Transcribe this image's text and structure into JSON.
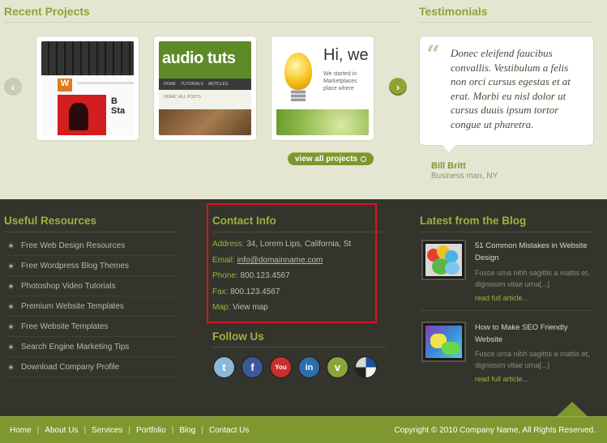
{
  "recent_projects": {
    "title": "Recent Projects",
    "prev_arrow": "‹",
    "next_arrow": "›",
    "view_all_label": "view all projects",
    "thumbs": [
      {
        "name": "project-thumb-1"
      },
      {
        "name": "project-thumb-2",
        "brand_text": "audio tuts",
        "tabs": [
          "HOME",
          "TUTORIALS",
          "ARTICLES"
        ],
        "crumb": "HOME  \\ ALL POSTS"
      },
      {
        "name": "project-thumb-3",
        "headline": "Hi, we",
        "body": "We started in Marketplaces place where"
      }
    ]
  },
  "testimonials": {
    "title": "Testimonials",
    "quote_mark": "“",
    "quote": "Donec eleifend faucibus convallis. Vestibulum a felis non orci cursus egestas et at erat. Morbi eu nisl dolor ut cursus duuis ipsum tortor congue ut pharetra.",
    "author": "Bill Britt",
    "role": "Business man, NY"
  },
  "useful_resources": {
    "title": "Useful Resources",
    "items": [
      "Free Web Design Resources",
      "Free Wordpress Blog Themes",
      "Photoshop Video Tutorials",
      "Premium Website Templates",
      "Free Website Templates",
      "Search Engine Marketing Tips",
      "Download Company Profile"
    ]
  },
  "contact_info": {
    "title": "Contact Info",
    "address_label": "Address:",
    "address": "34, Lorem Lips, California, St",
    "email_label": "Email:",
    "email": "info@domainname.com",
    "phone_label": "Phone:",
    "phone": "800.123.4567",
    "fax_label": "Fax:",
    "fax": "800.123.4567",
    "map_label": "Map:",
    "map": "View map",
    "highlight_color": "#d9141c"
  },
  "follow_us": {
    "title": "Follow Us",
    "icons": [
      {
        "name": "twitter-icon",
        "glyph": "t",
        "color": "#8ab8d8"
      },
      {
        "name": "facebook-icon",
        "glyph": "f",
        "color": "#3b5998"
      },
      {
        "name": "youtube-icon",
        "glyph": "You",
        "color": "#c9302c"
      },
      {
        "name": "linkedin-icon",
        "glyph": "in",
        "color": "#2d6ea8"
      },
      {
        "name": "vimeo-icon",
        "glyph": "v",
        "color": "#8aa63a"
      },
      {
        "name": "delicious-icon",
        "glyph": "",
        "color": "#f2f2f2"
      }
    ]
  },
  "latest_blog": {
    "title": "Latest from the Blog",
    "posts": [
      {
        "title": "51 Common Mistakes in Website Design",
        "excerpt": "Fusce urna nibh sagittis a mattis et, dignissim vitae urna[...]",
        "read_more": "read full article..."
      },
      {
        "title": "How to Make SEO Friendly Website",
        "excerpt": "Fusce urna nibh sagittis a mattis et, dignissim vitae urna[...]",
        "read_more": "read full article..."
      }
    ]
  },
  "bottom_bar": {
    "nav": [
      "Home",
      "About Us",
      "Services",
      "Portfolio",
      "Blog",
      "Contact Us"
    ],
    "separator": "|",
    "copyright": "Copyright © 2010 Company Name, All Rights Reserved."
  },
  "colors": {
    "accent": "#8fa33a",
    "footer_bg": "#34342c",
    "bottom_bar": "#7f972f",
    "page_bg": "#e4e6d2"
  }
}
